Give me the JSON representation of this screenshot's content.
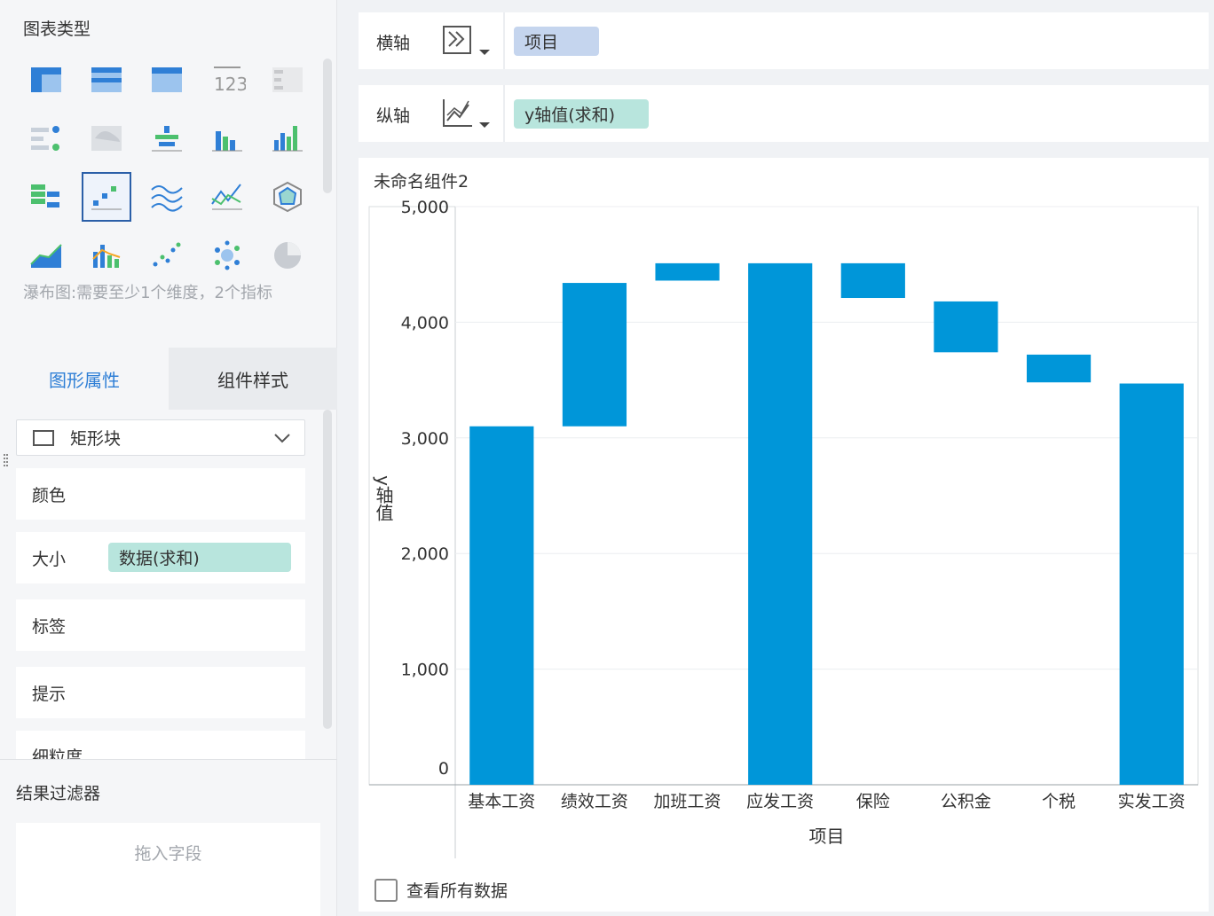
{
  "left_panel": {
    "title": "图表类型",
    "hint": "瀑布图:需要至少1个维度，2个指标",
    "chart_types": [
      {
        "name": "cross-table-icon",
        "selected": false
      },
      {
        "name": "group-table-icon",
        "selected": false
      },
      {
        "name": "detail-table-icon",
        "selected": false
      },
      {
        "name": "number-card-icon",
        "selected": false
      },
      {
        "name": "kpi-table-icon",
        "selected": false
      },
      {
        "name": "progress-bar-icon",
        "selected": false
      },
      {
        "name": "map-icon",
        "selected": false
      },
      {
        "name": "stacked-bar-icon",
        "selected": false
      },
      {
        "name": "grouped-bar-icon",
        "selected": false
      },
      {
        "name": "column-chart-icon",
        "selected": false
      },
      {
        "name": "horizontal-bar-icon",
        "selected": false
      },
      {
        "name": "waterfall-icon",
        "selected": true
      },
      {
        "name": "multi-line-icon",
        "selected": false
      },
      {
        "name": "line-chart-icon",
        "selected": false
      },
      {
        "name": "radar-icon",
        "selected": false
      },
      {
        "name": "area-chart-icon",
        "selected": false
      },
      {
        "name": "combo-chart-icon",
        "selected": false
      },
      {
        "name": "scatter-icon",
        "selected": false
      },
      {
        "name": "bubble-icon",
        "selected": false
      },
      {
        "name": "pie-icon",
        "selected": false
      }
    ],
    "tabs": [
      {
        "label": "图形属性"
      },
      {
        "label": "组件样式"
      }
    ],
    "shape_select": "矩形块",
    "props": [
      {
        "label": "颜色",
        "pill": ""
      },
      {
        "label": "大小",
        "pill": "数据(求和)"
      },
      {
        "label": "标签",
        "pill": ""
      },
      {
        "label": "提示",
        "pill": ""
      },
      {
        "label": "细粒度",
        "pill": ""
      }
    ],
    "filter_title": "结果过滤器",
    "drop_hint": "拖入字段"
  },
  "axes": {
    "x": {
      "label": "横轴",
      "field": "项目"
    },
    "y": {
      "label": "纵轴",
      "field": "y轴值(求和)"
    }
  },
  "chart_title": "未命名组件2",
  "view_all": "查看所有数据",
  "colors": {
    "bar": "#0096d9",
    "accent": "#2f7fd6"
  },
  "chart_data": {
    "type": "bar",
    "subtype": "waterfall",
    "categories": [
      "基本工资",
      "绩效工资",
      "加班工资",
      "应发工资",
      "保险",
      "公积金",
      "个税",
      "实发工资"
    ],
    "ranges": [
      [
        0,
        3100
      ],
      [
        3100,
        4340
      ],
      [
        4360,
        4510
      ],
      [
        0,
        4510
      ],
      [
        4210,
        4510
      ],
      [
        3740,
        4180
      ],
      [
        3480,
        3720
      ],
      [
        0,
        3470
      ]
    ],
    "xlabel": "项目",
    "ylabel": "y轴值",
    "ylim": [
      0,
      5000
    ],
    "yticks": [
      "5,000",
      "4,000",
      "3,000",
      "2,000",
      "1,000",
      "0"
    ],
    "ytick_values": [
      5000,
      4000,
      3000,
      2000,
      1000,
      0
    ],
    "grid": true
  }
}
